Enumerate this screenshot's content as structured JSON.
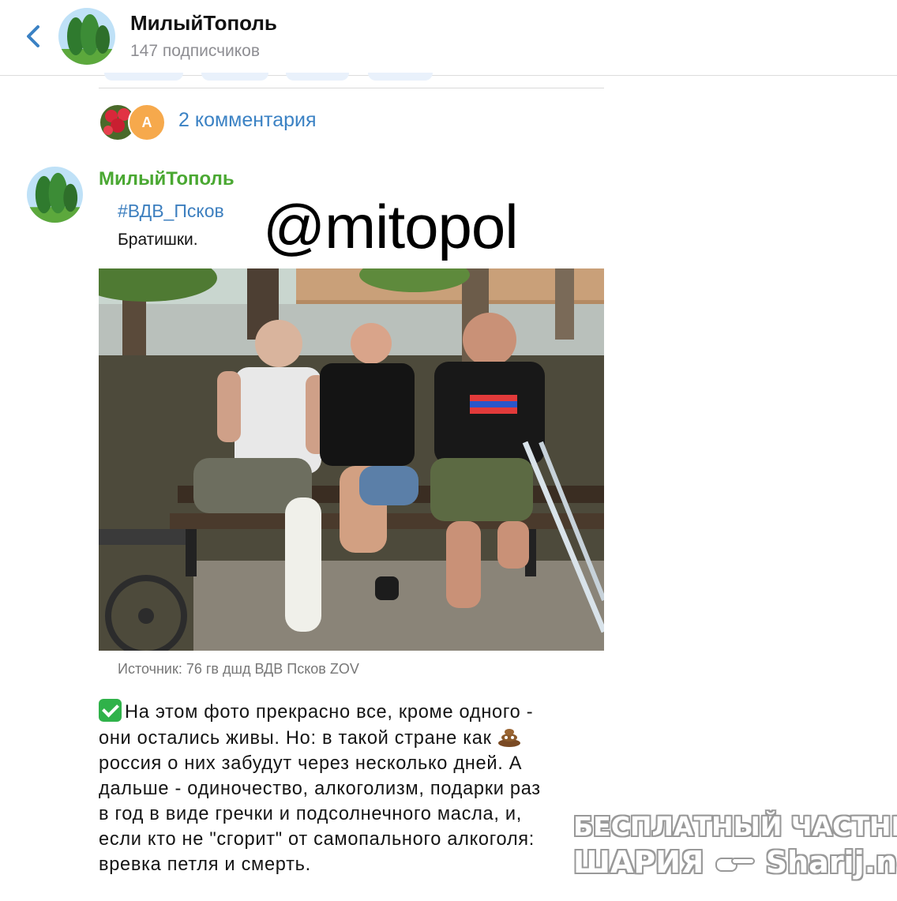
{
  "header": {
    "channel_name": "МилыйТополь",
    "subscribers": "147 подписчиков",
    "back_icon": "chevron-left-icon"
  },
  "comments": {
    "label": "2 комментария",
    "avatar2_letter": "А"
  },
  "post": {
    "author": "МилыйТополь",
    "screenshot": {
      "hashtag": "#ВДВ_Псков",
      "subtitle": "Братишки.",
      "watermark": "@mitopol",
      "source": "Источник: 76 гв дшд ВДВ Псков ZOV"
    },
    "text_lines": [
      "На этом фото прекрасно все, кроме одного -",
      "они остались живы. Но: в такой стране как",
      "россия о них забудут через несколько дней. А",
      "дальше - одиночество, алкоголизм, подарки раз",
      "в год в виде гречки и подсолнечного масла, и,",
      "если кто не \"сгорит\" от самопального алкоголя:",
      "вревка петля и смерть."
    ]
  },
  "watermark": {
    "line1": "БЕСПЛАТНЫЙ ЧАСТНЫЙ",
    "line2a": "ШАРИЯ",
    "line2b": "Sharij.net"
  },
  "colors": {
    "link": "#3b82c4",
    "author": "#4aa832",
    "check": "#30b24a"
  }
}
